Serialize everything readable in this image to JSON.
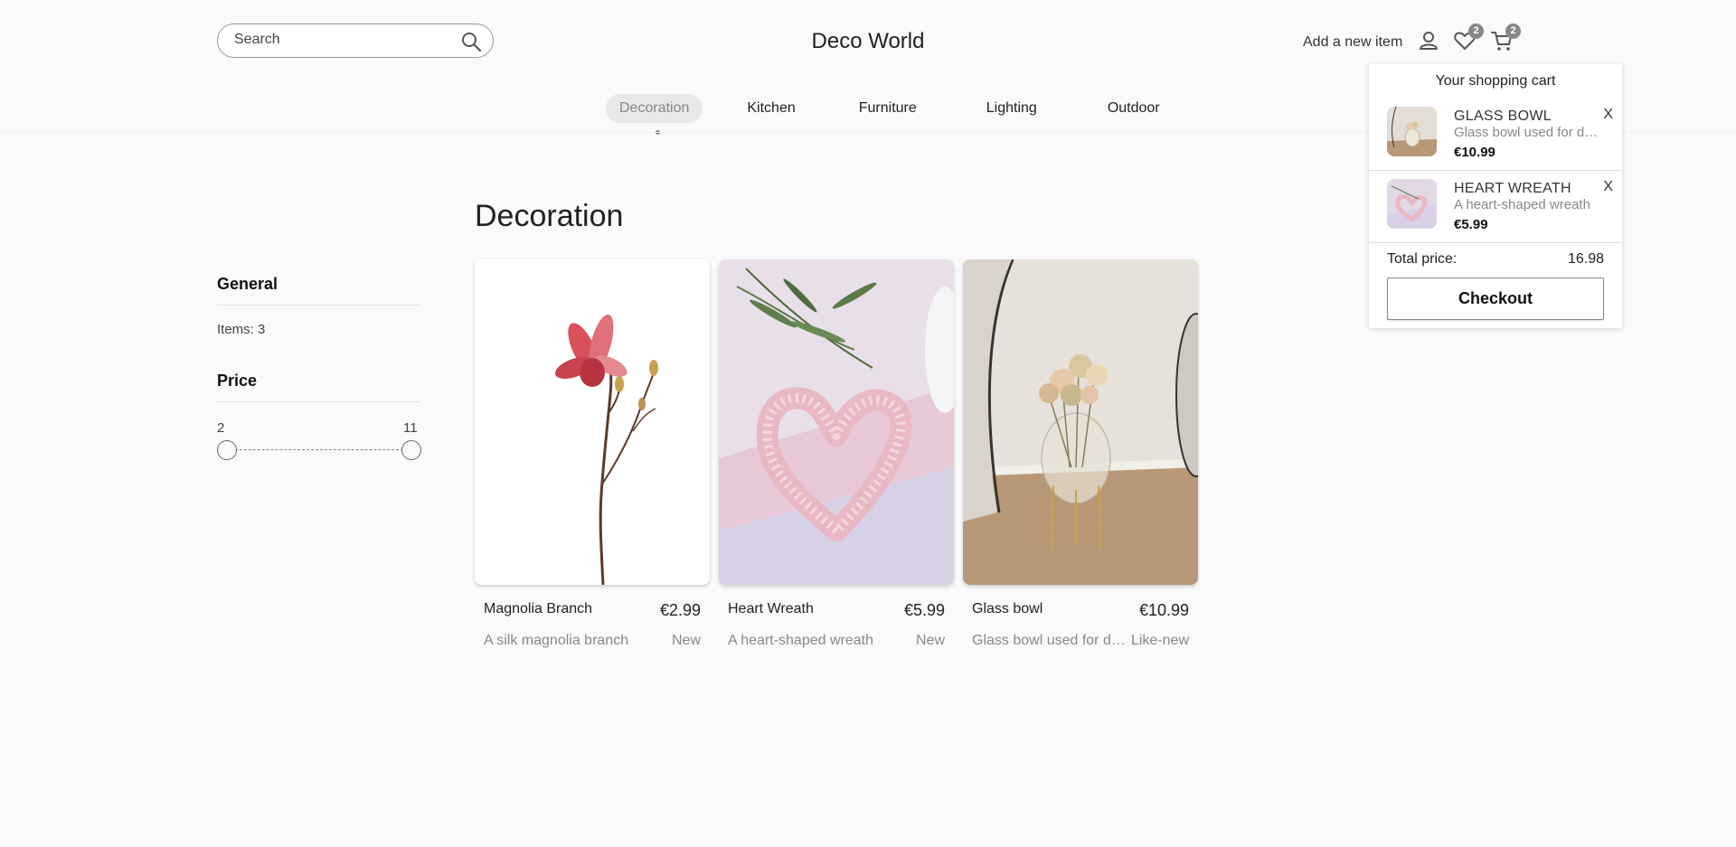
{
  "header": {
    "search_placeholder": "Search",
    "brand": "Deco World",
    "add_item_label": "Add a new item",
    "wishlist_count": "2",
    "cart_count": "2"
  },
  "nav": {
    "items": [
      "Decoration",
      "Kitchen",
      "Furniture",
      "Lighting",
      "Outdoor"
    ],
    "active": "Decoration"
  },
  "sidebar": {
    "general_heading": "General",
    "items_label": "Items: 3",
    "price_heading": "Price",
    "price_min": "2",
    "price_max": "11"
  },
  "main": {
    "title": "Decoration",
    "products": [
      {
        "name": "Magnolia Branch",
        "price": "€2.99",
        "description": "A silk magnolia branch",
        "condition": "New"
      },
      {
        "name": "Heart Wreath",
        "price": "€5.99",
        "description": "A heart-shaped wreath",
        "condition": "New"
      },
      {
        "name": "Glass bowl",
        "price": "€10.99",
        "description": "Glass bowl used for decoration",
        "condition": "Like-new"
      }
    ]
  },
  "cart": {
    "title": "Your shopping cart",
    "items": [
      {
        "name": "GLASS BOWL",
        "description": "Glass bowl used for decoration",
        "price": "€10.99",
        "remove": "X"
      },
      {
        "name": "HEART WREATH",
        "description": "A heart-shaped wreath",
        "price": "€5.99",
        "remove": "X"
      }
    ],
    "total_label": "Total price:",
    "total_value": "16.98",
    "checkout_label": "Checkout"
  }
}
